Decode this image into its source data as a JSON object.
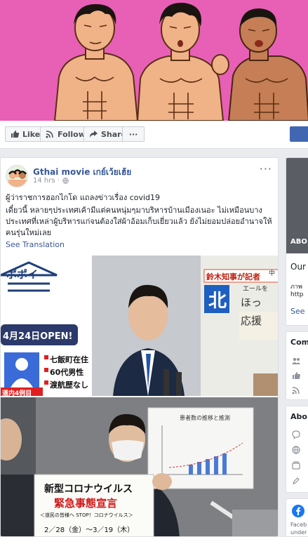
{
  "actions": {
    "like": "Like",
    "follow": "Follow",
    "share": "Share",
    "more": "···"
  },
  "post": {
    "page_name": "Gthai movie เกย์เว้ยเฮ้ย",
    "time": "14 hrs ·",
    "more": "···",
    "line1": "ผู้ว่าราชการฮอกไกโด แถลงข่าวเรื่อง covid19",
    "line2": "เดี๋ยวนี้ หลายๆประเทศเค้ามีแต่คนหนุ่มๆมาบริหารบ้านเมืองเนอะ ไม่เหมือนบาง",
    "line3": "ประเทศที่เหล่าผู้บริหารแก่จนต้องใส่ผ้าอ้อมเก็บเยี่ยวแล้ว ยังไม่ยอมปล่อยอำนาจให้",
    "line4": "คนรุ่นใหม่เลย",
    "see_translation": "See Translation"
  },
  "photo1": {
    "logo_text": "ポポイ",
    "open_label": "4月24日OPEN!",
    "info1": "七飯町在住",
    "info2": "60代男性",
    "info3": "渡航歴なし",
    "header": "鈴木知事が記者",
    "kita": "北",
    "ho": "ほっ",
    "support": "応援",
    "small": "エールを",
    "naka": "中",
    "red_small": "道内4例目"
  },
  "photo2": {
    "board_title": "患者数の推移と推測",
    "sign_line1": "新型コロナウイルス",
    "sign_line2": "緊急事態宣言",
    "sign_line3": "＜道民の皆様へ STOP！コロナウイルス＞",
    "sign_line4": "2／28（金）〜3／19（木）"
  },
  "right": {
    "about_dark": "ABO",
    "our": "Our",
    "line_a": "ภาพ",
    "line_b": "http",
    "see": "See",
    "community": "Com",
    "about": "Abo",
    "fb_line1": "Faceb",
    "fb_line2": "under"
  },
  "colors": {
    "cover_bg": "#e85fb6",
    "fb_blue": "#4267b2",
    "link": "#385898"
  }
}
